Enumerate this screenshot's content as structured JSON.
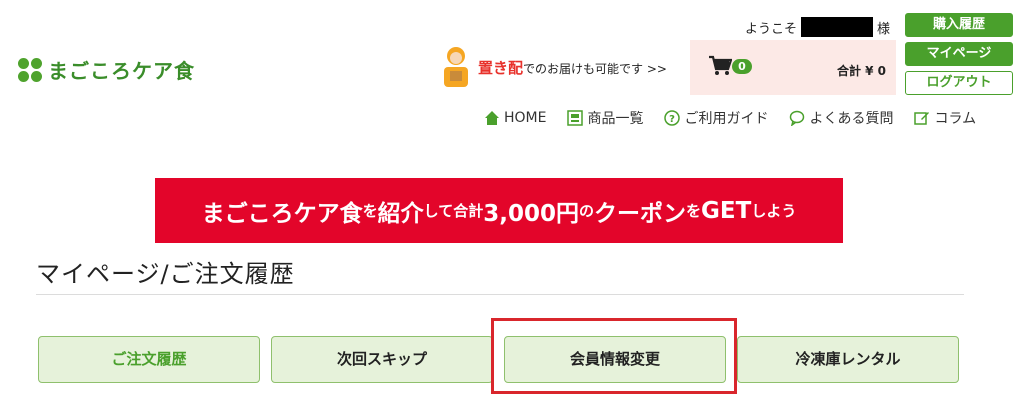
{
  "logo": {
    "text": "まごころケア食"
  },
  "header": {
    "welcome_prefix": "ようこそ",
    "welcome_suffix": "様",
    "buttons": {
      "history": "購入履歴",
      "mypage": "マイページ",
      "logout": "ログアウト"
    },
    "delivery": {
      "strong": "置き配",
      "rest": "でのお届けも可能です >>"
    },
    "cart": {
      "count": "0",
      "total_label": "合計 ¥ 0"
    }
  },
  "nav": {
    "items": [
      {
        "label": "HOME",
        "icon": "home-icon"
      },
      {
        "label": "商品一覧",
        "icon": "product-list-icon"
      },
      {
        "label": "ご利用ガイド",
        "icon": "help-icon"
      },
      {
        "label": "よくある質問",
        "icon": "faq-bubble-icon"
      },
      {
        "label": "コラム",
        "icon": "column-pen-icon"
      }
    ]
  },
  "banner": {
    "part1": "まごころケア食",
    "part2": "を",
    "part3": "紹介",
    "part4": "して合計",
    "part5": "3,000円",
    "part6": "の",
    "part7": "クーポン",
    "part8": "を",
    "part9": "GET",
    "part10": "しよう"
  },
  "page": {
    "title": "マイページ/ご注文履歴"
  },
  "tabs": [
    {
      "label": "ご注文履歴",
      "active": true
    },
    {
      "label": "次回スキップ",
      "active": false
    },
    {
      "label": "会員情報変更",
      "active": false
    },
    {
      "label": "冷凍庫レンタル",
      "active": false
    }
  ],
  "colors": {
    "brand_green": "#4aa02c",
    "banner_red": "#e3052a",
    "highlight_red": "#d9262c",
    "tab_bg": "#e6f2da"
  }
}
